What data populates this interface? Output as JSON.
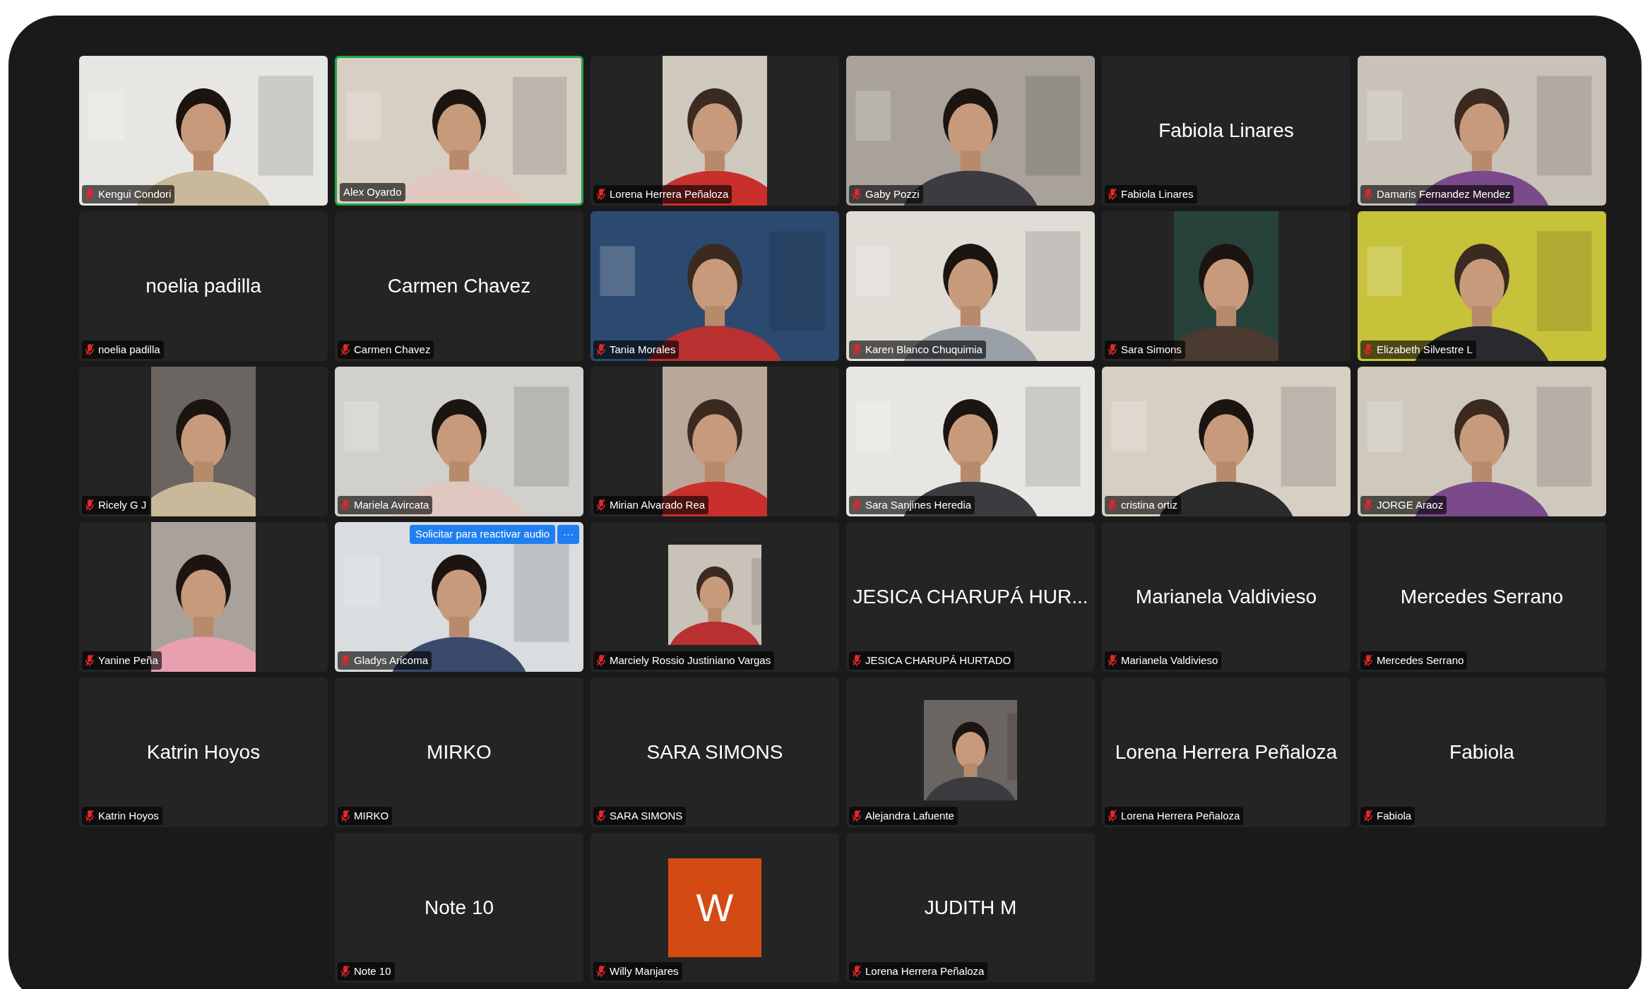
{
  "rows": [
    [
      {
        "kind": "video",
        "label": "Kengui Condori",
        "muted": true,
        "speaking": false
      },
      {
        "kind": "video",
        "label": "Alex Oyardo",
        "muted": false,
        "speaking": true
      },
      {
        "kind": "portrait",
        "label": "Lorena Herrera Peñaloza",
        "muted": true,
        "speaking": false
      },
      {
        "kind": "video",
        "label": "Gaby Pozzi",
        "muted": true,
        "speaking": false
      },
      {
        "kind": "name",
        "display_name": "Fabiola Linares",
        "label": "Fabiola Linares",
        "muted": true,
        "speaking": false
      },
      {
        "kind": "video",
        "label": "Damaris Fernandez Mendez",
        "muted": true,
        "speaking": false
      }
    ],
    [
      {
        "kind": "name",
        "display_name": "noelia padilla",
        "label": "noelia padilla",
        "muted": true,
        "speaking": false
      },
      {
        "kind": "name",
        "display_name": "Carmen Chavez",
        "label": "Carmen Chavez",
        "muted": true,
        "speaking": false
      },
      {
        "kind": "video",
        "label": "Tania Morales",
        "muted": true,
        "speaking": false
      },
      {
        "kind": "video",
        "label": "Karen Blanco Chuquimia",
        "muted": true,
        "speaking": false
      },
      {
        "kind": "portrait",
        "label": "Sara Simons",
        "muted": true,
        "speaking": false
      },
      {
        "kind": "video",
        "label": "Elizabeth Silvestre L",
        "muted": true,
        "speaking": false
      }
    ],
    [
      {
        "kind": "portrait",
        "label": "Ricely G J",
        "muted": true,
        "speaking": false
      },
      {
        "kind": "video",
        "label": "Mariela Avircata",
        "muted": true,
        "speaking": false
      },
      {
        "kind": "portrait",
        "label": "Mirian Alvarado Rea",
        "muted": true,
        "speaking": false
      },
      {
        "kind": "video",
        "label": "Sara Sanjines Heredia",
        "muted": true,
        "speaking": false
      },
      {
        "kind": "video",
        "label": "cristina ortiz",
        "muted": true,
        "speaking": false
      },
      {
        "kind": "video",
        "label": "JORGE Araoz",
        "muted": true,
        "speaking": false
      }
    ],
    [
      {
        "kind": "portrait",
        "label": "Yanine Peña",
        "muted": true,
        "speaking": false
      },
      {
        "kind": "video",
        "label": "Gladys Aricoma",
        "muted": true,
        "speaking": false,
        "request_button": "Solicitar para reactivar audio",
        "more_button": "···"
      },
      {
        "kind": "thumb",
        "label": "Marciely Rossio Justiniano Vargas",
        "muted": true,
        "speaking": false
      },
      {
        "kind": "name",
        "display_name": "JESICA CHARUPÁ HUR...",
        "label": "JESICA CHARUPÁ HURTADO",
        "muted": true,
        "speaking": false
      },
      {
        "kind": "name",
        "display_name": "Marianela Valdivieso",
        "label": "Marianela Valdivieso",
        "muted": true,
        "speaking": false
      },
      {
        "kind": "name",
        "display_name": "Mercedes Serrano",
        "label": "Mercedes Serrano",
        "muted": true,
        "speaking": false
      }
    ],
    [
      {
        "kind": "name",
        "display_name": "Katrin Hoyos",
        "label": "Katrin Hoyos",
        "muted": true,
        "speaking": false
      },
      {
        "kind": "name",
        "display_name": "MIRKO",
        "label": "MIRKO",
        "muted": true,
        "speaking": false
      },
      {
        "kind": "name",
        "display_name": "SARA SIMONS",
        "label": "SARA SIMONS",
        "muted": true,
        "speaking": false
      },
      {
        "kind": "thumb",
        "label": "Alejandra Lafuente",
        "muted": true,
        "speaking": false
      },
      {
        "kind": "name",
        "display_name": "Lorena Herrera Peñaloza",
        "label": "Lorena Herrera Peñaloza",
        "muted": true,
        "speaking": false
      },
      {
        "kind": "name",
        "display_name": "Fabiola",
        "label": "Fabiola",
        "muted": true,
        "speaking": false
      }
    ],
    [
      {
        "kind": "name",
        "display_name": "Note 10",
        "label": "Note 10",
        "muted": true,
        "speaking": false
      },
      {
        "kind": "avatar",
        "avatar_letter": "W",
        "label": "Willy Manjares",
        "muted": true,
        "speaking": false
      },
      {
        "kind": "name",
        "display_name": "JUDITH M",
        "label": "Lorena Herrera Peñaloza",
        "muted": true,
        "speaking": false
      }
    ]
  ]
}
